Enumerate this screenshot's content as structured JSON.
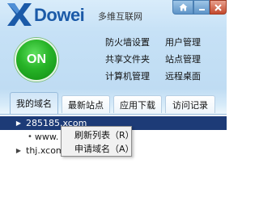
{
  "app": {
    "logo_text": "Dowei",
    "subtitle": "多维互联网"
  },
  "power": {
    "label": "ON",
    "color": "#27b327"
  },
  "quick_links": [
    {
      "label": "防火墙设置"
    },
    {
      "label": "用户管理"
    },
    {
      "label": "共享文件夹"
    },
    {
      "label": "站点管理"
    },
    {
      "label": "计算机管理"
    },
    {
      "label": "远程桌面"
    }
  ],
  "tabs": [
    {
      "label": "我的域名",
      "active": true
    },
    {
      "label": "最新站点",
      "active": false
    },
    {
      "label": "应用下载",
      "active": false
    },
    {
      "label": "访问记录",
      "active": false
    }
  ],
  "tree": {
    "rows": [
      {
        "label": "285185.xcom",
        "selected": true
      },
      {
        "label": "www."
      },
      {
        "label": "thj.xcom"
      }
    ]
  },
  "context_menu": {
    "items": [
      {
        "label": "刷新列表（R）"
      },
      {
        "label": "申请域名（A）"
      }
    ]
  },
  "colors": {
    "brand": "#1b5aa8",
    "selection": "#1d3b77",
    "close_button": "#c3492d"
  }
}
